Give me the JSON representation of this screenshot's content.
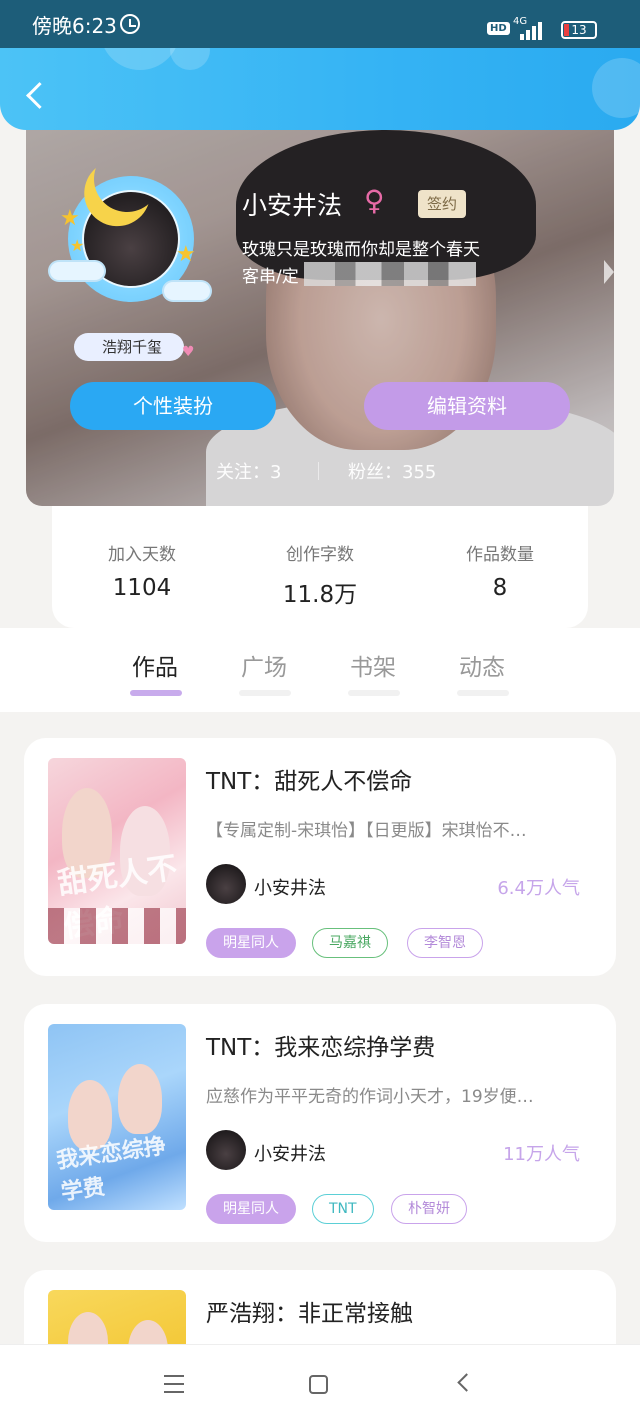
{
  "status_bar": {
    "time": "傍晚6:23",
    "hd_label": "HD",
    "network_label": "4G",
    "battery_level": "13",
    "icons": [
      "alarm-icon",
      "hd-icon",
      "signal-icon",
      "battery-icon"
    ]
  },
  "header": {
    "back_icon": "chevron-left-icon",
    "accent_color": "#35b3f4"
  },
  "profile": {
    "username": "小安井法",
    "gender_icon": "♀",
    "contract_badge": "签约",
    "bio_line1": "玫瑰只是玫瑰而你却是整个春天",
    "bio_line2": "客串/定",
    "fan_badge": "浩翔千玺",
    "dress_button": "个性装扮",
    "edit_button": "编辑资料",
    "following": "关注：3",
    "fans": "粉丝：355"
  },
  "stats": [
    {
      "label": "加入天数",
      "value": "1104"
    },
    {
      "label": "创作字数",
      "value": "11.8万"
    },
    {
      "label": "作品数量",
      "value": "8"
    }
  ],
  "tabs": [
    {
      "label": "作品",
      "active": true
    },
    {
      "label": "广场",
      "active": false
    },
    {
      "label": "书架",
      "active": false
    },
    {
      "label": "动态",
      "active": false
    }
  ],
  "works": [
    {
      "title": "TNT：甜死人不偿命",
      "description": "【专属定制-宋琪怡】【日更版】宋琪怡不…",
      "author": "小安井法",
      "popularity": "6.4万人气",
      "cover_art_text": "甜死人不偿命",
      "tags": [
        "明星同人",
        "马嘉祺",
        "李智恩"
      ]
    },
    {
      "title": "TNT：我来恋综挣学费",
      "description": "应慈作为平平无奇的作词小天才，19岁便…",
      "author": "小安井法",
      "popularity": "11万人气",
      "cover_art_text": "我来恋综挣学费",
      "tags": [
        "明星同人",
        "TNT",
        "朴智妍"
      ]
    },
    {
      "title": "严浩翔：非正常接触"
    }
  ],
  "navbar": {
    "icons": [
      "menu-icon",
      "home-icon",
      "back-icon"
    ]
  }
}
